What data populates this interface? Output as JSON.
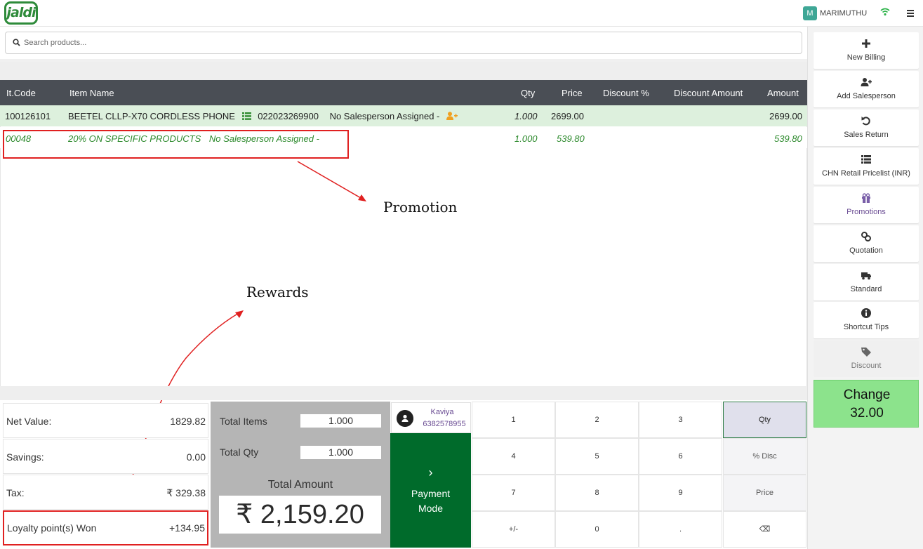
{
  "app": {
    "logo_text": "jaldi"
  },
  "user": {
    "avatar_initial": "M",
    "name": "MARIMUTHU"
  },
  "search": {
    "placeholder": "Search products..."
  },
  "table": {
    "headers": [
      "It.Code",
      "Item Name",
      "Qty",
      "Price",
      "Discount %",
      "Discount Amount",
      "Amount"
    ],
    "rows": [
      {
        "code": "100126101",
        "name": "BEETEL CLLP-X70 CORDLESS PHONE",
        "barcode": "022023269900",
        "salesperson": "No Salesperson Assigned -",
        "qty": "1.000",
        "price": "2699.00",
        "amount": "2699.00"
      },
      {
        "code": "00048",
        "name": "20% ON SPECIFIC PRODUCTS",
        "salesperson": "No Salesperson Assigned -",
        "qty": "1.000",
        "price": "539.80",
        "amount": "539.80"
      }
    ]
  },
  "annotations": {
    "promotion": "Promotion",
    "rewards": "Rewards"
  },
  "summary": {
    "net_value_label": "Net Value:",
    "net_value": "1829.82",
    "savings_label": "Savings:",
    "savings": "0.00",
    "tax_label": "Tax:",
    "tax": "₹ 329.38",
    "loyalty_label": "Loyalty point(s) Won",
    "loyalty": "+134.95"
  },
  "totals": {
    "items_label": "Total Items",
    "items": "1.000",
    "qty_label": "Total Qty",
    "qty": "1.000",
    "amount_label": "Total Amount",
    "amount": "₹ 2,159.20"
  },
  "customer": {
    "name": "Kaviya",
    "phone": "6382578955"
  },
  "payment": {
    "chevron": "›",
    "label_line1": "Payment",
    "label_line2": "Mode"
  },
  "keypad": {
    "keys": [
      "1",
      "2",
      "3",
      "4",
      "5",
      "6",
      "7",
      "8",
      "9",
      "+/-",
      "0",
      "."
    ],
    "modes": [
      "Qty",
      "% Disc",
      "Price",
      "⌫"
    ]
  },
  "sidebar": {
    "new_billing": "New Billing",
    "add_salesperson": "Add Salesperson",
    "sales_return": "Sales Return",
    "pricelist": "CHN Retail Pricelist (INR)",
    "promotions": "Promotions",
    "quotation": "Quotation",
    "standard": "Standard",
    "shortcut_tips": "Shortcut Tips",
    "discount": "Discount"
  },
  "change": {
    "label": "Change",
    "value": "32.00"
  },
  "colors": {
    "header_bg": "#4a4e55",
    "row_highlight": "#ddf0dd",
    "promo_text": "#2d8a2d",
    "payment_bg": "#006b2b",
    "change_bg": "#8ce38c",
    "annotation_red": "#e02020"
  }
}
